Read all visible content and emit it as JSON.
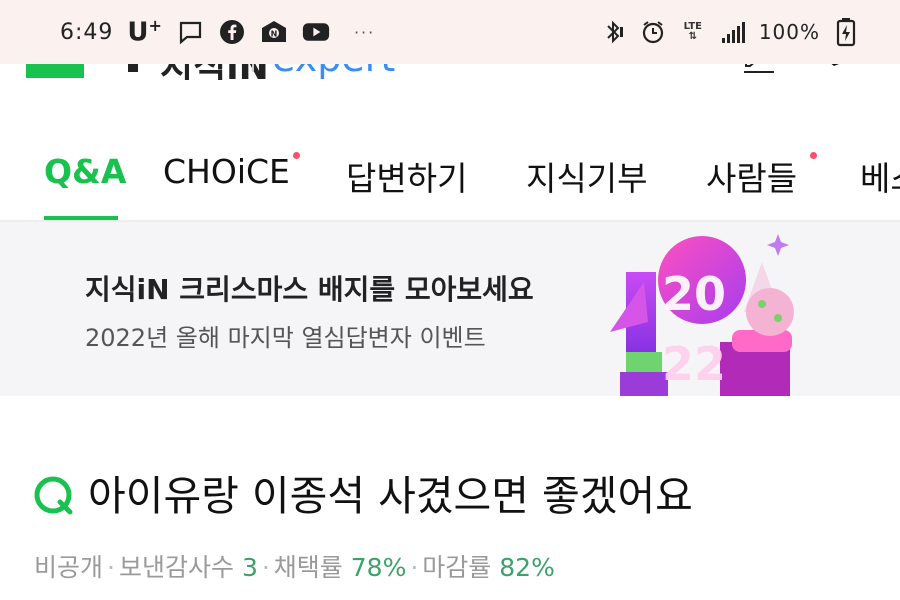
{
  "status_bar": {
    "time": "6:49",
    "carrier": "U",
    "carrier_sup": "+",
    "lte": "LTE",
    "battery": "100%",
    "more": "···"
  },
  "header": {
    "service_name_partial": "지식iN",
    "expert_label": "expert"
  },
  "tabs": [
    {
      "label": "Q&A",
      "active": true,
      "dot": false
    },
    {
      "label": "CHOiCE",
      "active": false,
      "dot": true
    },
    {
      "label": "답변하기",
      "active": false,
      "dot": false
    },
    {
      "label": "지식기부",
      "active": false,
      "dot": false
    },
    {
      "label": "사람들",
      "active": false,
      "dot": true
    },
    {
      "label": "베스",
      "active": false,
      "dot": false
    }
  ],
  "banner": {
    "title": "지식iN 크리스마스 배지를 모아보세요",
    "subtitle": "2022년 올해 마지막 열심답변자 이벤트",
    "art_year_top": "20",
    "art_year_bottom": "22"
  },
  "question": {
    "title": "아이유랑 이종석 사겼으면 좋겠어요",
    "visibility": "비공개",
    "thanks_label": "보낸감사수",
    "thanks_count": "3",
    "adoption_label": "채택률",
    "adoption_rate": "78%",
    "close_label": "마감률",
    "close_rate": "82%"
  },
  "colors": {
    "accent_green": "#19c24f",
    "notify_dot": "#ff4e6b",
    "meta_number": "#3aa36a"
  }
}
